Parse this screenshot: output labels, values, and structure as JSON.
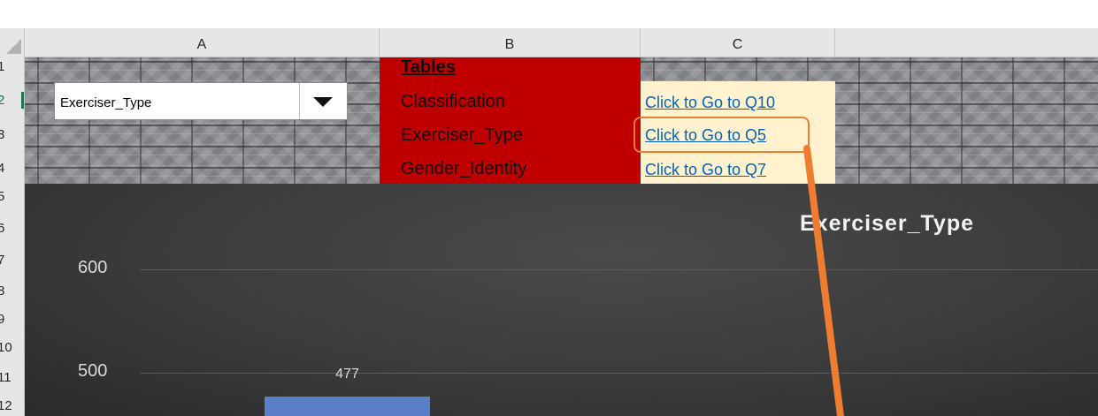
{
  "columns": [
    {
      "letter": "A"
    },
    {
      "letter": "B"
    },
    {
      "letter": "C"
    }
  ],
  "rows": [
    {
      "label": "1"
    },
    {
      "label": "2"
    },
    {
      "label": "3"
    },
    {
      "label": "4"
    },
    {
      "label": "5"
    },
    {
      "label": "6"
    },
    {
      "label": "7"
    },
    {
      "label": "8"
    },
    {
      "label": "9"
    },
    {
      "label": "10"
    },
    {
      "label": "11"
    },
    {
      "label": "12"
    }
  ],
  "dropdown": {
    "value": "Exerciser_Type"
  },
  "tables": {
    "heading": "Tables",
    "items": [
      "Classification",
      "Exerciser_Type",
      "Gender_Identity"
    ]
  },
  "links": [
    "Click to Go to Q10",
    "Click to Go to Q5",
    "Click to Go to Q7"
  ],
  "colors": {
    "tables_bg": "#c00000",
    "link": "#0563c1",
    "link_bg": "#fff2cc",
    "highlight": "#ed7d31",
    "bar": "#5b7fc7"
  },
  "chart_data": {
    "type": "bar",
    "title": "Exerciser_Type",
    "y_ticks": [
      600,
      500
    ],
    "values": [
      477
    ],
    "data_labels": [
      "477"
    ]
  }
}
